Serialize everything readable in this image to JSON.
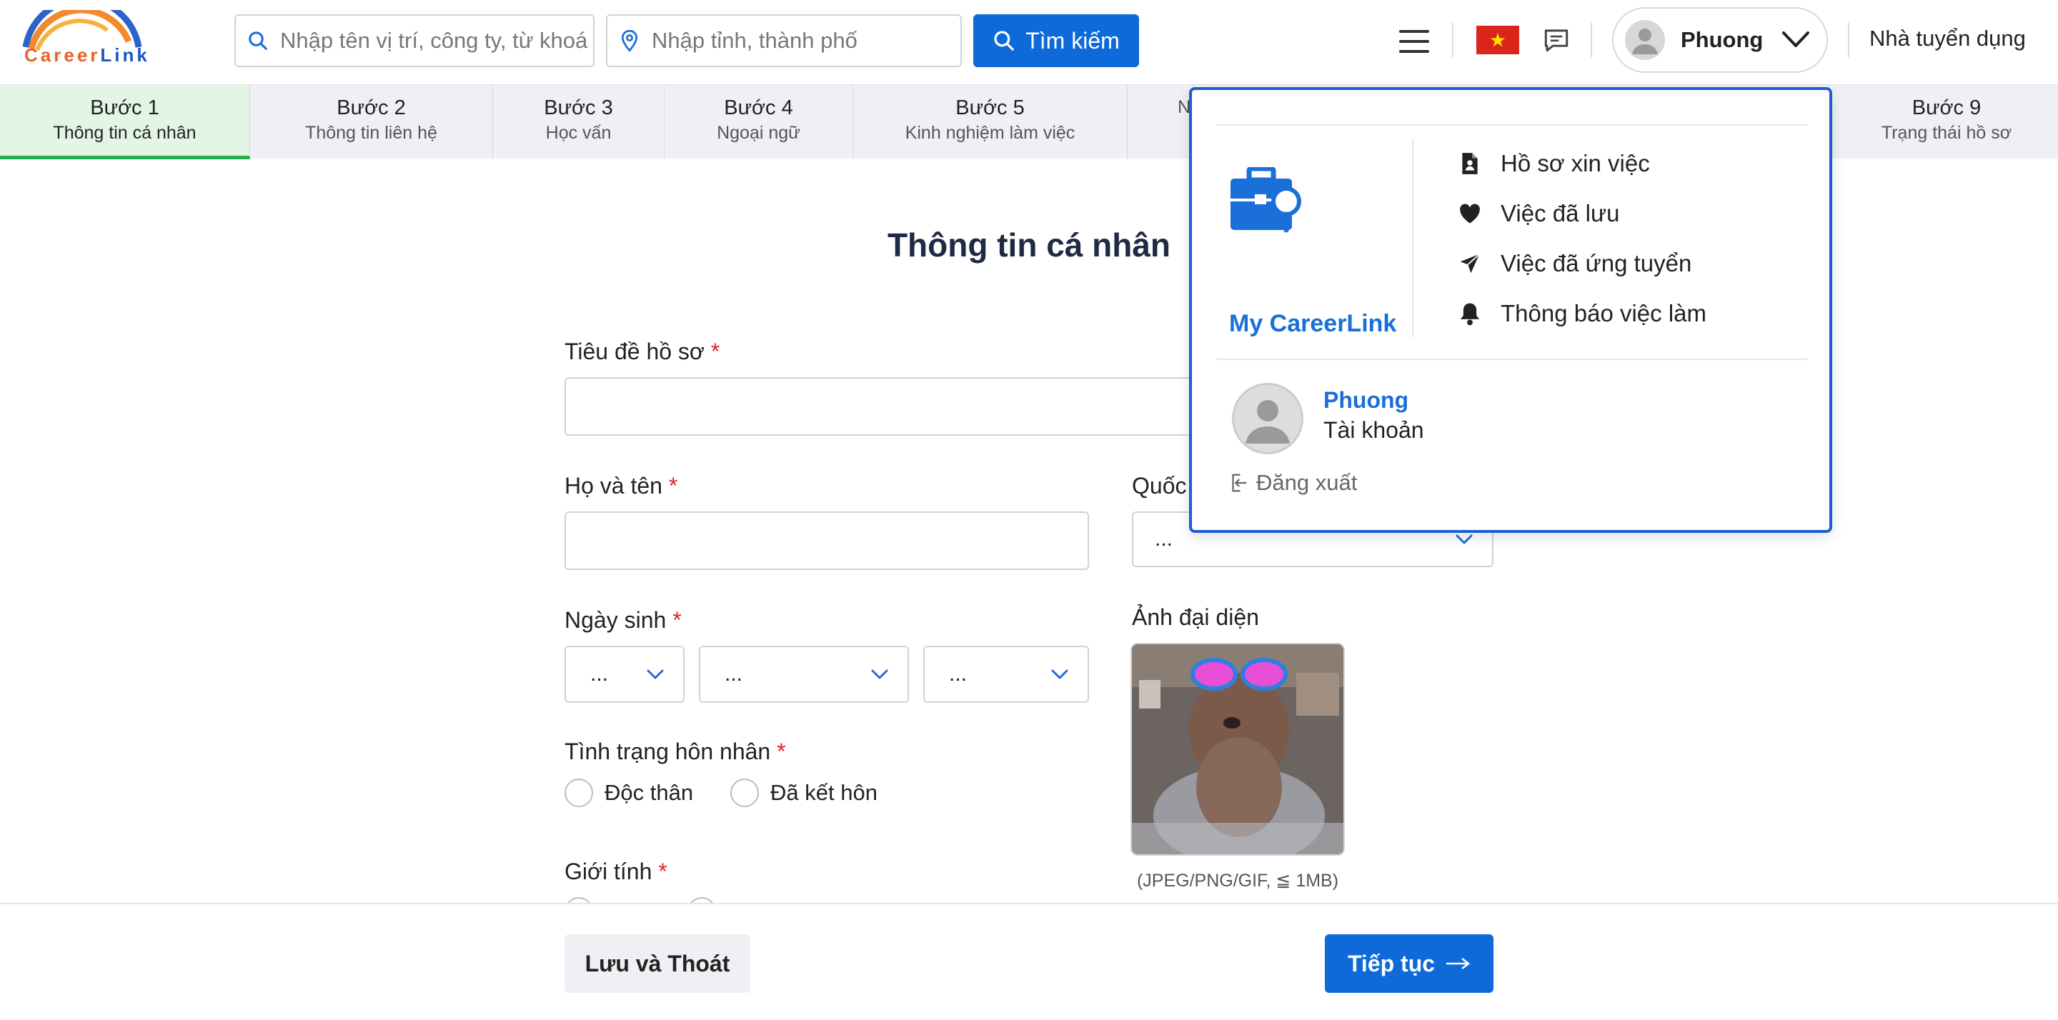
{
  "header": {
    "logo_text_1": "Career",
    "logo_text_2": "Link",
    "search_placeholder": "Nhập tên vị trí, công ty, từ khoá",
    "location_placeholder": "Nhập tỉnh, thành phố",
    "search_button": "Tìm kiếm",
    "user_name": "Phuong",
    "employer_link": "Nhà tuyển dụng"
  },
  "steps": [
    {
      "title": "Bước 1",
      "subtitle": "Thông tin cá nhân"
    },
    {
      "title": "Bước 2",
      "subtitle": "Thông tin liên hệ"
    },
    {
      "title": "Bước 3",
      "subtitle": "Học vấn"
    },
    {
      "title": "Bước 4",
      "subtitle": "Ngoại ngữ"
    },
    {
      "title": "Bước 5",
      "subtitle": "Kinh nghiệm làm việc"
    },
    {
      "title": "",
      "subtitle": "N"
    },
    {
      "title": "Bước 9",
      "subtitle": "Trạng thái hồ sơ"
    }
  ],
  "form": {
    "title": "Thông tin cá nhân",
    "required_mark": "*",
    "cv_title_label": "Tiêu đề hồ sơ",
    "full_name_label": "Họ và tên",
    "nationality_label": "Quốc",
    "nationality_value": "...",
    "birthday_label": "Ngày sinh",
    "birthday_day": "...",
    "birthday_month": "...",
    "birthday_year": "...",
    "marital_label": "Tình trạng hôn nhân",
    "marital_options": [
      "Độc thân",
      "Đã kết hôn"
    ],
    "gender_label": "Giới tính",
    "avatar_label": "Ảnh đại diện",
    "avatar_hint": "(JPEG/PNG/GIF, ≦ 1MB)"
  },
  "footer": {
    "save_exit": "Lưu và Thoát",
    "next": "Tiếp tục"
  },
  "dropdown": {
    "brand": "My CareerLink",
    "items": [
      {
        "label": "Hồ sơ xin việc",
        "icon": "file-user-icon"
      },
      {
        "label": "Việc đã lưu",
        "icon": "heart-icon"
      },
      {
        "label": "Việc đã ứng tuyển",
        "icon": "paper-plane-icon"
      },
      {
        "label": "Thông báo việc làm",
        "icon": "bell-icon"
      }
    ],
    "user_name": "Phuong",
    "account": "Tài khoản",
    "logout": "Đăng xuất"
  },
  "colors": {
    "primary": "#0d6ad8",
    "active_step_bg": "#e3f6e6",
    "active_step_border": "#22b14c",
    "required": "#e02424",
    "dropdown_border": "#1a5fd0"
  }
}
